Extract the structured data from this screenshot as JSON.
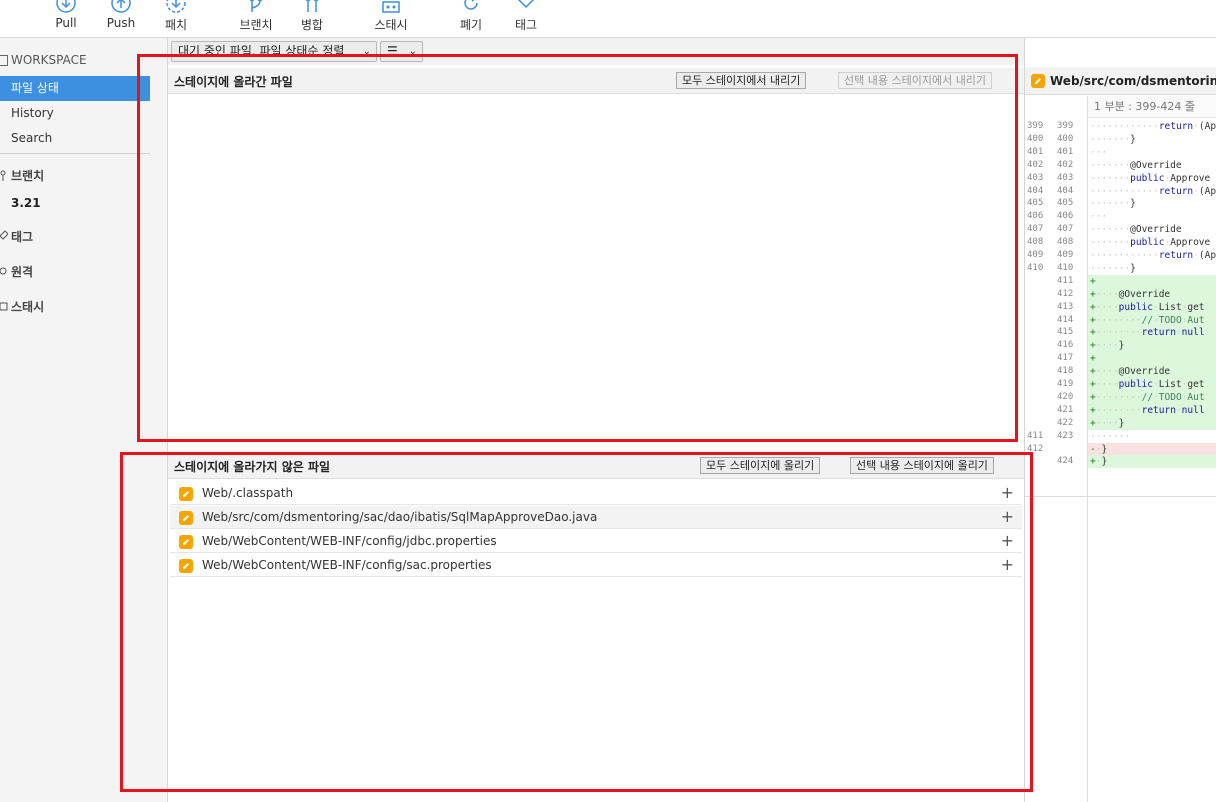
{
  "toolbar": {
    "items": [
      {
        "label": "Pull",
        "icon": "pull-icon"
      },
      {
        "label": "Push",
        "icon": "push-icon"
      },
      {
        "label": "패치",
        "icon": "patch-icon"
      },
      {
        "label": "브랜치",
        "icon": "branch-icon"
      },
      {
        "label": "병합",
        "icon": "merge-icon"
      },
      {
        "label": "스태시",
        "icon": "stash-icon"
      },
      {
        "label": "폐기",
        "icon": "discard-icon"
      },
      {
        "label": "태그",
        "icon": "tag-icon"
      }
    ]
  },
  "sidebar": {
    "workspace_label": "WORKSPACE",
    "items": [
      {
        "label": "파일 상태",
        "active": true
      },
      {
        "label": "History",
        "active": false
      },
      {
        "label": "Search",
        "active": false
      }
    ],
    "sections": {
      "branches": "브랜치",
      "current_branch": "3.21",
      "tags": "태그",
      "remotes": "원격",
      "stashes": "스태시"
    }
  },
  "filter": {
    "sort_dropdown": "대기 중인 파일, 파일 상태순 정렬",
    "view_dropdown": "☰"
  },
  "staged": {
    "title": "스테이지에 올라간 파일",
    "unstage_all": "모두 스테이지에서 내리기",
    "unstage_selected": "선택 내용 스테이지에서 내리기",
    "files": []
  },
  "unstaged": {
    "title": "스테이지에 올라가지 않은 파일",
    "stage_all": "모두 스테이지에 올리기",
    "stage_selected": "선택 내용 스테이지에 올리기",
    "files": [
      {
        "path": "Web/.classpath",
        "add": "+"
      },
      {
        "path": "Web/src/com/dsmentoring/sac/dao/ibatis/SqlMapApproveDao.java",
        "add": "+"
      },
      {
        "path": "Web/WebContent/WEB-INF/config/jdbc.properties",
        "add": "+"
      },
      {
        "path": "Web/WebContent/WEB-INF/config/sac.properties",
        "add": "+"
      }
    ]
  },
  "diff": {
    "file_title": "Web/src/com/dsmentoring/sac/",
    "hunk_label": "1 부분 : 399-424 줄",
    "lines": [
      {
        "old": "399",
        "new": "399",
        "type": "ctx",
        "text": "············return·(App"
      },
      {
        "old": "400",
        "new": "400",
        "type": "ctx",
        "text": "·······}"
      },
      {
        "old": "401",
        "new": "401",
        "type": "ctx",
        "text": "···"
      },
      {
        "old": "402",
        "new": "402",
        "type": "ctx",
        "text": "·······@Override"
      },
      {
        "old": "403",
        "new": "403",
        "type": "ctx",
        "text": "·······public·Approve"
      },
      {
        "old": "404",
        "new": "404",
        "type": "ctx",
        "text": "············return·(App"
      },
      {
        "old": "405",
        "new": "405",
        "type": "ctx",
        "text": "·······}"
      },
      {
        "old": "406",
        "new": "406",
        "type": "ctx",
        "text": "···"
      },
      {
        "old": "407",
        "new": "407",
        "type": "ctx",
        "text": "·······@Override"
      },
      {
        "old": "408",
        "new": "408",
        "type": "ctx",
        "text": "·······public·Approve"
      },
      {
        "old": "409",
        "new": "409",
        "type": "ctx",
        "text": "············return·(App"
      },
      {
        "old": "410",
        "new": "410",
        "type": "ctx",
        "text": "·······}"
      },
      {
        "old": "",
        "new": "411",
        "type": "add",
        "text": "+"
      },
      {
        "old": "",
        "new": "412",
        "type": "add",
        "text": "+····@Override"
      },
      {
        "old": "",
        "new": "413",
        "type": "add",
        "text": "+····public·List·get"
      },
      {
        "old": "",
        "new": "414",
        "type": "add",
        "text": "+········//·TODO·Aut"
      },
      {
        "old": "",
        "new": "415",
        "type": "add",
        "text": "+········return·null"
      },
      {
        "old": "",
        "new": "416",
        "type": "add",
        "text": "+····}"
      },
      {
        "old": "",
        "new": "417",
        "type": "add",
        "text": "+"
      },
      {
        "old": "",
        "new": "418",
        "type": "add",
        "text": "+····@Override"
      },
      {
        "old": "",
        "new": "419",
        "type": "add",
        "text": "+····public·List·get"
      },
      {
        "old": "",
        "new": "420",
        "type": "add",
        "text": "+········//·TODO·Aut"
      },
      {
        "old": "",
        "new": "421",
        "type": "add",
        "text": "+········return·null"
      },
      {
        "old": "",
        "new": "422",
        "type": "add",
        "text": "+····}"
      },
      {
        "old": "411",
        "new": "423",
        "type": "ctx",
        "text": "·······"
      },
      {
        "old": "412",
        "new": "",
        "type": "del",
        "text": "-·}"
      },
      {
        "old": "",
        "new": "424",
        "type": "add",
        "text": "+·}"
      }
    ]
  },
  "colors": {
    "accent": "#3d8fe0",
    "annotation_red": "#e8121b",
    "modified_icon": "#f5a400",
    "added_line": "#dcf7dc",
    "removed_line": "#fbe2e2"
  }
}
